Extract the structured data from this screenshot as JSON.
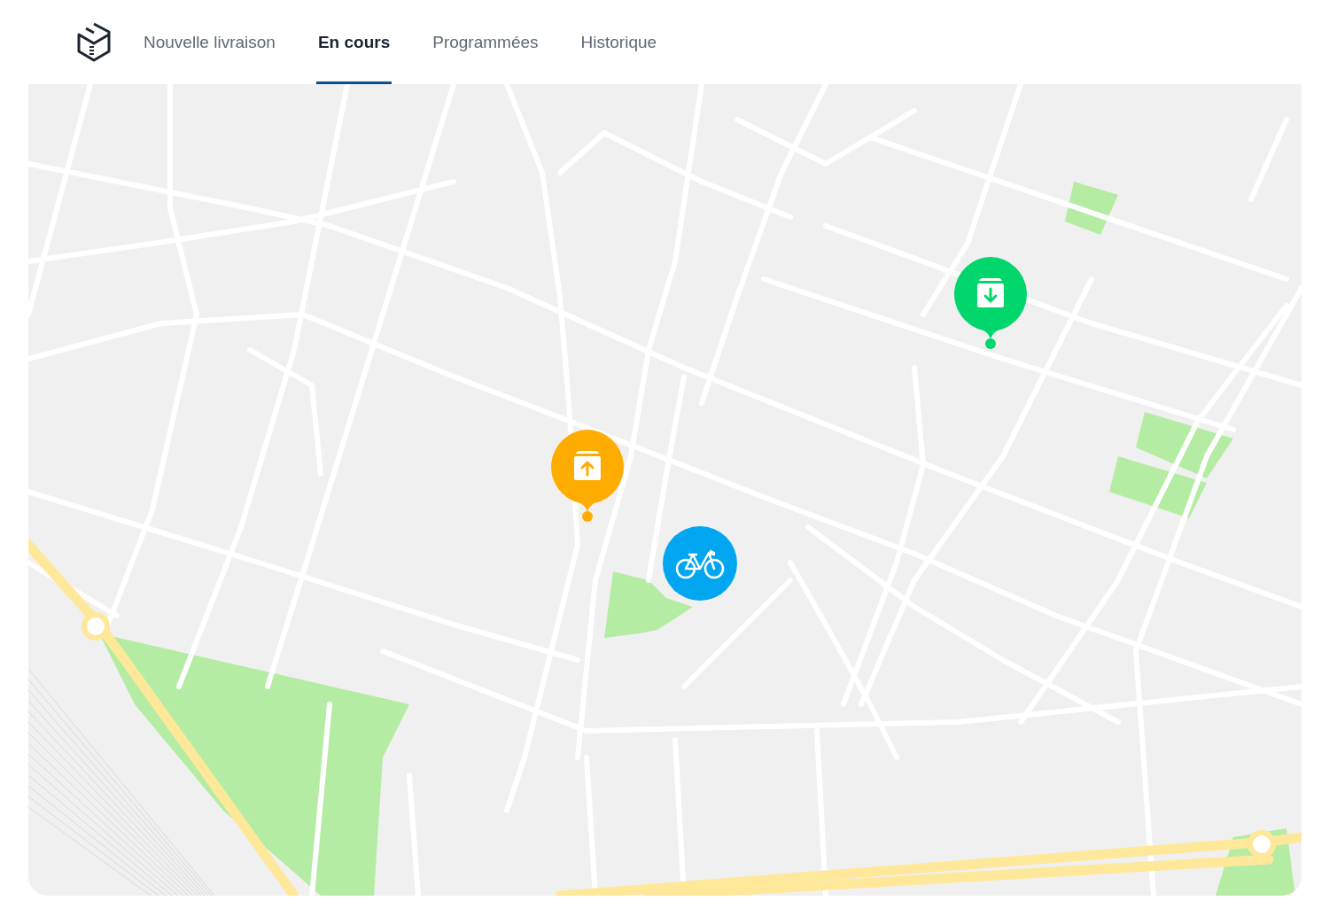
{
  "nav": {
    "tabs": [
      {
        "label": "Nouvelle livraison",
        "selected": false
      },
      {
        "label": "En cours",
        "selected": true
      },
      {
        "label": "Programmées",
        "selected": false
      },
      {
        "label": "Historique",
        "selected": false
      }
    ]
  },
  "map": {
    "markers": [
      {
        "kind": "pickup",
        "color": "#ffac00"
      },
      {
        "kind": "dropoff",
        "color": "#00d66b"
      },
      {
        "kind": "courier",
        "color": "#00a6f0"
      }
    ]
  }
}
